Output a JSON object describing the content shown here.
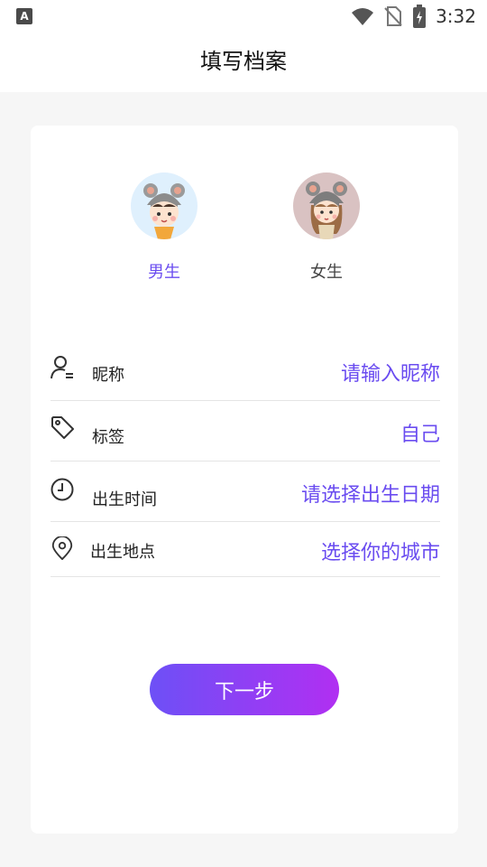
{
  "status_bar": {
    "app_badge": "A",
    "time": "3:32",
    "icons": [
      "wifi-icon",
      "no-sim-icon",
      "battery-charging-icon"
    ]
  },
  "header": {
    "title": "填写档案"
  },
  "gender": {
    "male_label": "男生",
    "female_label": "女生",
    "selected": "male",
    "selected_color": "#6a4cf0"
  },
  "form": {
    "nickname": {
      "label": "昵称",
      "value": "请输入昵称",
      "icon": "user-list-icon"
    },
    "tag": {
      "label": "标签",
      "value": "自己",
      "icon": "tag-icon"
    },
    "birth_time": {
      "label": "出生时间",
      "value": "请选择出生日期",
      "icon": "clock-icon"
    },
    "birth_place": {
      "label": "出生地点",
      "value": "选择你的城市",
      "icon": "location-pin-icon"
    }
  },
  "next_button": {
    "label": "下一步"
  },
  "colors": {
    "accent": "#6a4cf0",
    "gradient_start": "#6d50f6",
    "gradient_end": "#b12ff2"
  }
}
